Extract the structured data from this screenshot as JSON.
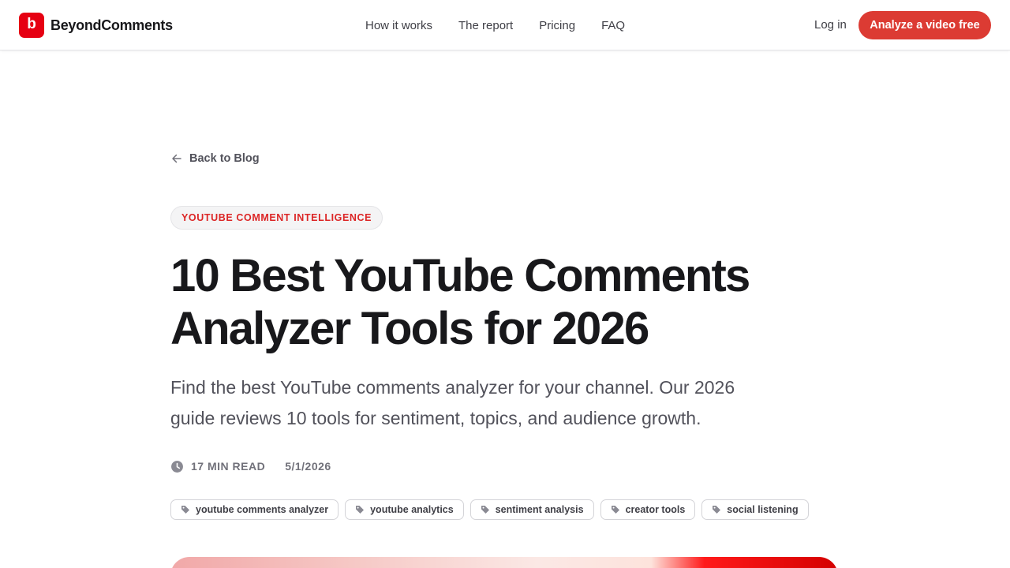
{
  "brand": {
    "logo_letter": "b",
    "name": "BeyondComments",
    "accent": "#e60012"
  },
  "nav": {
    "items": [
      {
        "label": "How it works"
      },
      {
        "label": "The report"
      },
      {
        "label": "Pricing"
      },
      {
        "label": "FAQ"
      }
    ],
    "login_label": "Log in",
    "cta_label": "Analyze a video free",
    "cta_color": "#dc3b33"
  },
  "article": {
    "back_label": "Back to Blog",
    "back_icon": "arrow-left-icon",
    "category": "YOUTUBE COMMENT INTELLIGENCE",
    "title_line1": "10 Best YouTube Comments",
    "title_line2": "Analyzer Tools for 2026",
    "subtitle": "Find the best YouTube comments analyzer for your channel. Our 2026 guide reviews 10 tools for sentiment, topics, and audience growth.",
    "read_time": "17 MIN READ",
    "read_icon": "clock-icon",
    "date": "5/1/2026",
    "tags": [
      {
        "label": "youtube comments analyzer"
      },
      {
        "label": "youtube analytics"
      },
      {
        "label": "sentiment analysis"
      },
      {
        "label": "creator tools"
      },
      {
        "label": "social listening"
      }
    ],
    "tag_icon": "tag-icon"
  }
}
